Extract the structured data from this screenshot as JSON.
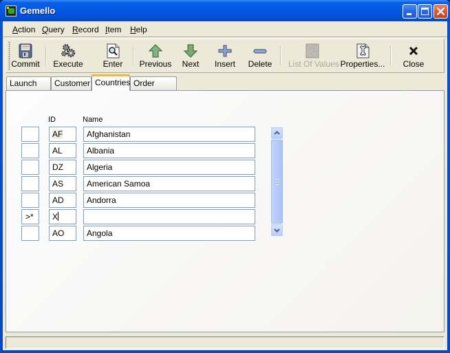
{
  "window": {
    "title": "Gemello",
    "controls": {
      "minimize": "minimize",
      "maximize": "maximize",
      "close": "close"
    }
  },
  "menubar": {
    "items": [
      {
        "label": "Action",
        "mnemonic": "A"
      },
      {
        "label": "Query",
        "mnemonic": "Q"
      },
      {
        "label": "Record",
        "mnemonic": "R"
      },
      {
        "label": "Item",
        "mnemonic": "I"
      },
      {
        "label": "Help",
        "mnemonic": "H"
      }
    ]
  },
  "toolbar": {
    "buttons": [
      {
        "label": "Commit",
        "icon": "floppy-disk-icon",
        "enabled": true
      },
      {
        "label": "Execute",
        "icon": "gears-icon",
        "enabled": true
      },
      {
        "label": "Enter",
        "icon": "magnifier-page-icon",
        "enabled": true
      },
      {
        "label": "Previous",
        "icon": "arrow-up-icon",
        "enabled": true
      },
      {
        "label": "Next",
        "icon": "arrow-down-icon",
        "enabled": true
      },
      {
        "label": "Insert",
        "icon": "plus-icon",
        "enabled": true
      },
      {
        "label": "Delete",
        "icon": "minus-icon",
        "enabled": true
      },
      {
        "label": "List Of Values",
        "icon": "list-of-values-icon",
        "enabled": false
      },
      {
        "label": "Properties...",
        "icon": "properties-wrench-icon",
        "enabled": true
      },
      {
        "label": "Close",
        "icon": "close-x-icon",
        "enabled": true
      }
    ]
  },
  "tabs": [
    {
      "label": "Launch Pad",
      "active": false
    },
    {
      "label": "Customer",
      "active": false
    },
    {
      "label": "Countries",
      "active": true
    },
    {
      "label": "Order Entry",
      "active": false
    }
  ],
  "grid": {
    "columns": {
      "id": "ID",
      "name": "Name"
    },
    "rows": [
      {
        "indicator": "",
        "id": "AF",
        "name": "Afghanistan"
      },
      {
        "indicator": "",
        "id": "AL",
        "name": "Albania"
      },
      {
        "indicator": "",
        "id": "DZ",
        "name": "Algeria"
      },
      {
        "indicator": "",
        "id": "AS",
        "name": "American Samoa"
      },
      {
        "indicator": "",
        "id": "AD",
        "name": "Andorra"
      },
      {
        "indicator": ">*",
        "id": "X",
        "name": ""
      },
      {
        "indicator": "",
        "id": "AO",
        "name": "Angola"
      }
    ],
    "current_row_index": 5
  },
  "statusbar": {
    "text": ""
  },
  "colors": {
    "titlebar": "#0553dc",
    "client_bg": "#ece9d8",
    "panel_bg": "#fcfcfe",
    "field_border": "#7f9db9",
    "active_tab_accent": "#f0b53c",
    "scrollbar": "#b8cdf8"
  }
}
